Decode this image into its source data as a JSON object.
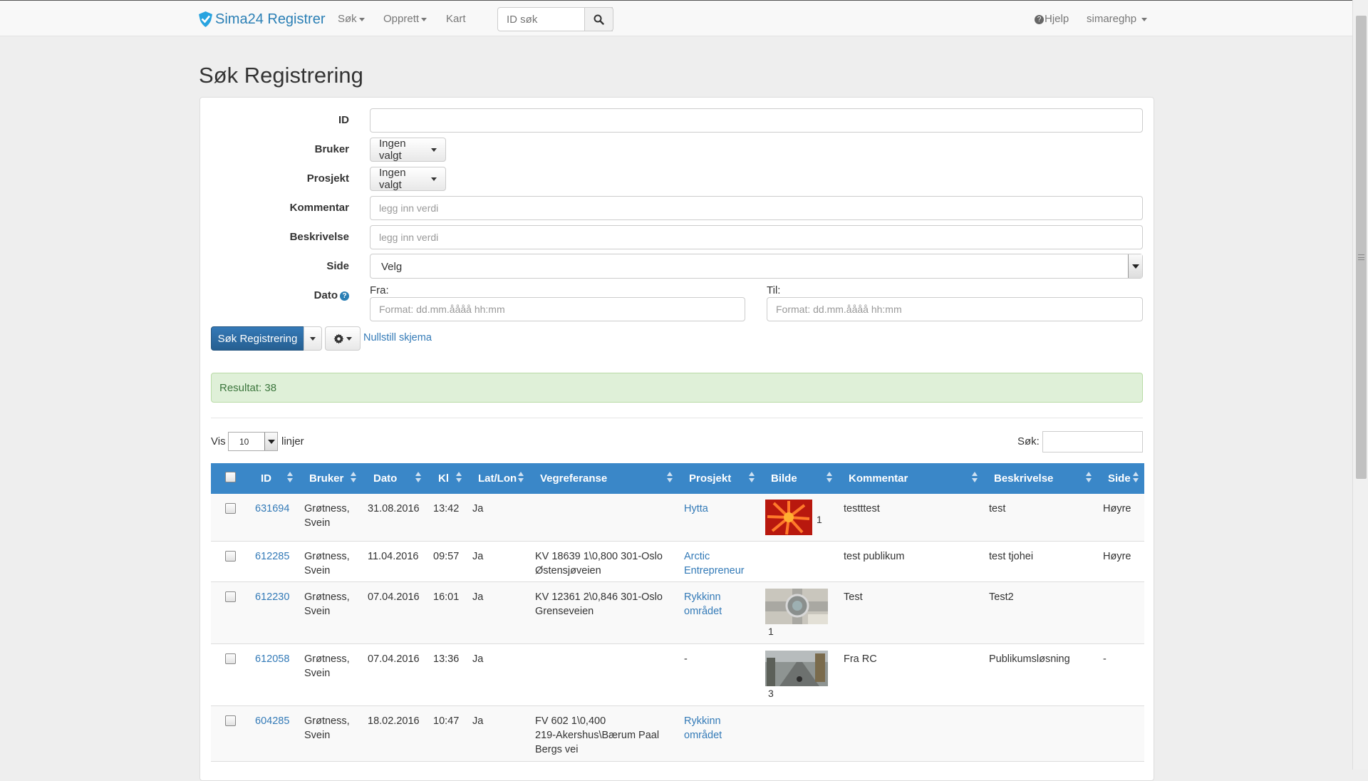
{
  "navbar": {
    "brand": "Sima24 Registrer",
    "menu": [
      {
        "label": "Søk",
        "dropdown": true
      },
      {
        "label": "Opprett",
        "dropdown": true
      },
      {
        "label": "Kart",
        "dropdown": false
      }
    ],
    "search_placeholder": "ID søk",
    "help_label": "Hjelp",
    "user_label": "simareghp"
  },
  "page": {
    "title": "Søk Registrering"
  },
  "form": {
    "id_label": "ID",
    "id_value": "",
    "bruker_label": "Bruker",
    "bruker_value": "Ingen valgt",
    "prosjekt_label": "Prosjekt",
    "prosjekt_value": "Ingen valgt",
    "kommentar_label": "Kommentar",
    "kommentar_placeholder": "legg inn verdi",
    "beskrivelse_label": "Beskrivelse",
    "beskrivelse_placeholder": "legg inn verdi",
    "side_label": "Side",
    "side_value": "Velg",
    "dato_label": "Dato",
    "fra_label": "Fra:",
    "til_label": "Til:",
    "date_placeholder": "Format: dd.mm.åååå hh:mm",
    "search_button": "Søk Registrering",
    "reset_link": "Nullstill skjema"
  },
  "result": {
    "text": "Resultat: 38"
  },
  "table_controls": {
    "show_label": "Vis",
    "page_length": "10",
    "lines_label": "linjer",
    "search_label": "Søk:"
  },
  "table": {
    "columns": [
      "ID",
      "Bruker",
      "Dato",
      "Kl",
      "Lat/Lon",
      "Vegreferanse",
      "Prosjekt",
      "Bilde",
      "Kommentar",
      "Beskrivelse",
      "Side"
    ],
    "rows": [
      {
        "id": "631694",
        "bruker1": "Grøtness,",
        "bruker2": "Svein",
        "dato": "31.08.2016",
        "kl": "13:42",
        "latlon": "Ja",
        "veg1": "",
        "veg2": "",
        "veg3": "",
        "prosjekt1": "Hytta",
        "prosjekt2": "",
        "bilde_count": "1",
        "kommentar": "testttest",
        "beskrivelse": "test",
        "side": "Høyre"
      },
      {
        "id": "612285",
        "bruker1": "Grøtness,",
        "bruker2": "Svein",
        "dato": "11.04.2016",
        "kl": "09:57",
        "latlon": "Ja",
        "veg1": "KV 18639 1\\0,800 301-Oslo",
        "veg2": "Østensjøveien",
        "veg3": "",
        "prosjekt1": "Arctic",
        "prosjekt2": "Entrepreneur",
        "bilde_count": "",
        "kommentar": "test publikum",
        "beskrivelse": "test tjohei",
        "side": "Høyre"
      },
      {
        "id": "612230",
        "bruker1": "Grøtness,",
        "bruker2": "Svein",
        "dato": "07.04.2016",
        "kl": "16:01",
        "latlon": "Ja",
        "veg1": "KV 12361 2\\0,846 301-Oslo",
        "veg2": "Grenseveien",
        "veg3": "",
        "prosjekt1": "Rykkinn",
        "prosjekt2": "området",
        "bilde_count": "1",
        "kommentar": "Test",
        "beskrivelse": "Test2",
        "side": ""
      },
      {
        "id": "612058",
        "bruker1": "Grøtness,",
        "bruker2": "Svein",
        "dato": "07.04.2016",
        "kl": "13:36",
        "latlon": "Ja",
        "veg1": "",
        "veg2": "",
        "veg3": "",
        "prosjekt1": "-",
        "prosjekt2": "",
        "bilde_count": "3",
        "kommentar": "Fra RC",
        "beskrivelse": "Publikumsløsning",
        "side": "-"
      },
      {
        "id": "604285",
        "bruker1": "Grøtness,",
        "bruker2": "Svein",
        "dato": "18.02.2016",
        "kl": "10:47",
        "latlon": "Ja",
        "veg1": "FV 602 1\\0,400",
        "veg2": "219-Akershus\\Bærum Paal",
        "veg3": "Bergs vei",
        "prosjekt1": "Rykkinn",
        "prosjekt2": "området",
        "bilde_count": "",
        "kommentar": "",
        "beskrivelse": "",
        "side": ""
      }
    ]
  },
  "colors": {
    "brand": "#2a7fb5",
    "table_header": "#3a87c8",
    "primary_button": "#2f6ea8",
    "success_bg": "#dff0d8"
  },
  "icons": [
    "check-shield-logo-icon",
    "search-icon",
    "question-circle-icon",
    "gear-icon",
    "caret-down-icon",
    "sort-icon"
  ]
}
